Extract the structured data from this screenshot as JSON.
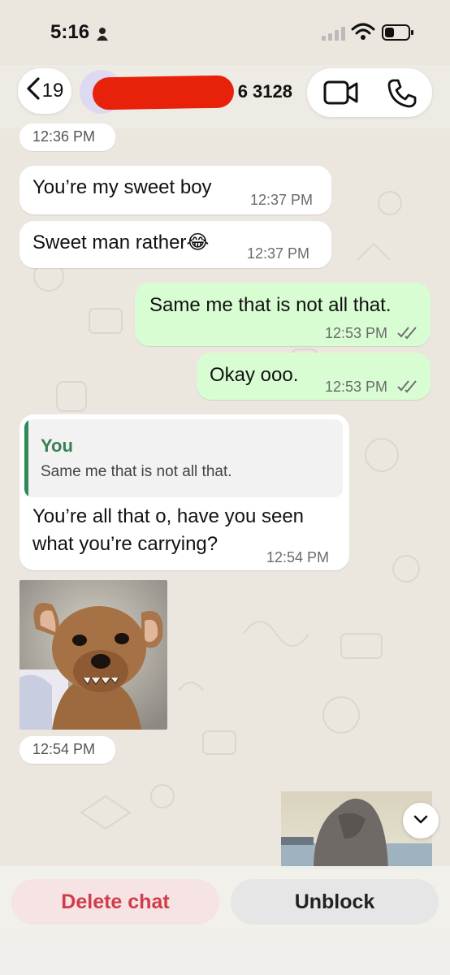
{
  "status_bar": {
    "time": "5:16"
  },
  "header": {
    "back_count": "19",
    "contact_visible": "6 3128",
    "icons": {
      "back": "chevron-left-icon",
      "video": "video-camera-icon",
      "call": "phone-icon"
    }
  },
  "date_chip": "12:36 PM",
  "messages": [
    {
      "dir": "in",
      "text": "You’re my sweet boy",
      "time": "12:37 PM"
    },
    {
      "dir": "in",
      "text": "Sweet man rather😂",
      "time": "12:37 PM"
    },
    {
      "dir": "out",
      "text": "Same me that is not all that.",
      "time": "12:53 PM"
    },
    {
      "dir": "out",
      "text": "Okay ooo.",
      "time": "12:53 PM"
    },
    {
      "dir": "in",
      "reply_to": {
        "author": "You",
        "text": "Same me that is not all that."
      },
      "text_line1": "You’re all that o, have you seen",
      "text_line2": "what you’re carrying?",
      "time": "12:54 PM"
    },
    {
      "dir": "in",
      "type": "image",
      "time": "12:54 PM"
    }
  ],
  "actions": {
    "delete": "Delete chat",
    "unblock": "Unblock"
  },
  "colors": {
    "outgoing": "#d9fdd3",
    "incoming": "#ffffff",
    "delete_text": "#d13b4c",
    "reply_accent": "#2e8b57"
  }
}
